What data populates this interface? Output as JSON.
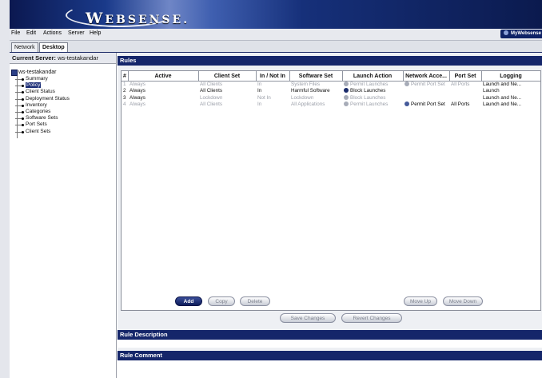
{
  "banner": {
    "logo_prefix": "W",
    "logo_rest": "EBSENSE."
  },
  "menu": [
    "File",
    "Edit",
    "Actions",
    "Server",
    "Help"
  ],
  "mywebsense": "MyWebsense",
  "tabs": [
    "Network",
    "Desktop"
  ],
  "current_server": {
    "label": "Current Server:",
    "value": "ws-testakandar"
  },
  "tree": {
    "root": "ws-testakandar",
    "items": [
      "Summary",
      "Policy",
      "Client Status",
      "Deployment Status",
      "Inventory",
      "Categories",
      "Software Sets",
      "Port Sets",
      "Client Sets"
    ],
    "selected": "Policy"
  },
  "rules": {
    "header": "Rules",
    "columns": [
      "#",
      "Active",
      "Client Set",
      "In / Not In",
      "Software Set",
      "Launch Action",
      "Network Acce...",
      "Port Set",
      "Logging"
    ],
    "rows": [
      {
        "num": "1",
        "active": "Always",
        "client_set": "All Clients",
        "in_not_in": "In",
        "software_set": "System Files",
        "launch_action": "Permit Launches",
        "launch_icon": "permit-icon",
        "network_access": "Permit Port Set",
        "port_set": "All Ports",
        "logging": "Launch and Ne...",
        "disabled": true
      },
      {
        "num": "2",
        "active": "Always",
        "client_set": "All Clients",
        "in_not_in": "In",
        "software_set": "Harmful Software",
        "launch_action": "Block Launches",
        "launch_icon": "block-icon",
        "network_access": "",
        "port_set": "",
        "logging": "Launch",
        "disabled": false
      },
      {
        "num": "3",
        "active": "Always",
        "client_set": "Lockdown",
        "in_not_in": "Not In",
        "software_set": "Lockdown",
        "launch_action": "Block Launches",
        "launch_icon": "block-icon",
        "network_access": "",
        "port_set": "",
        "logging": "Launch and Ne...",
        "disabled": false,
        "partial": true
      },
      {
        "num": "4",
        "active": "Always",
        "client_set": "All Clients",
        "in_not_in": "In",
        "software_set": "All Applications",
        "launch_action": "Permit Launches",
        "launch_icon": "permit-icon",
        "network_access": "Permit Port Set",
        "port_set": "All Ports",
        "logging": "Launch and Ne...",
        "disabled": true,
        "network_enabled": true
      }
    ]
  },
  "buttons": {
    "add": "Add",
    "copy": "Copy",
    "delete": "Delete",
    "move_up": "Move Up",
    "move_down": "Move Down",
    "save": "Save Changes",
    "revert": "Revert Changes"
  },
  "sections": {
    "rule_description": "Rule Description",
    "rule_comment": "Rule Comment"
  },
  "colors": {
    "navy": "#15266a",
    "disabled_text": "#9a9ea8"
  }
}
